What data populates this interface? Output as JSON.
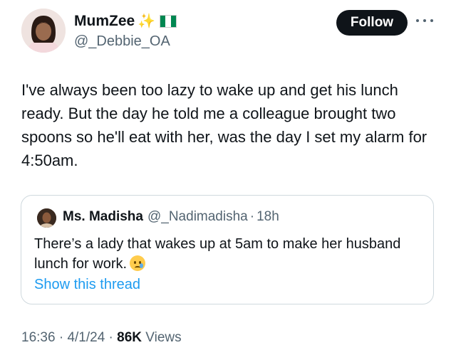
{
  "author": {
    "display_name": "MumZee",
    "handle": "@_Debbie_OA",
    "name_emoji": "✨"
  },
  "follow_button": {
    "label": "Follow"
  },
  "tweet": {
    "text": "I've always been too lazy to wake up and get his lunch ready. But the day he told me a colleague brought two spoons so he'll eat with her, was the day I set my alarm for 4:50am."
  },
  "quote": {
    "name": "Ms. Madisha",
    "handle": "@_Nadimadisha",
    "separator": "·",
    "time": "18h",
    "text": "There’s a lady that wakes up at 5am to make her husband lunch for work.",
    "show_thread": "Show this thread"
  },
  "meta": {
    "time": "16:36",
    "sep1": "·",
    "date": "4/1/24",
    "sep2": "·",
    "views_count": "86K",
    "views_label": "Views"
  },
  "colors": {
    "text": "#0f1419",
    "secondary": "#536471",
    "link": "#1d9bf0",
    "border": "#cfd9de",
    "flag_green": "#008751"
  },
  "icons": [
    "sparkles-icon",
    "nigeria-flag-icon",
    "more-icon",
    "crying-face-emoji-icon"
  ]
}
